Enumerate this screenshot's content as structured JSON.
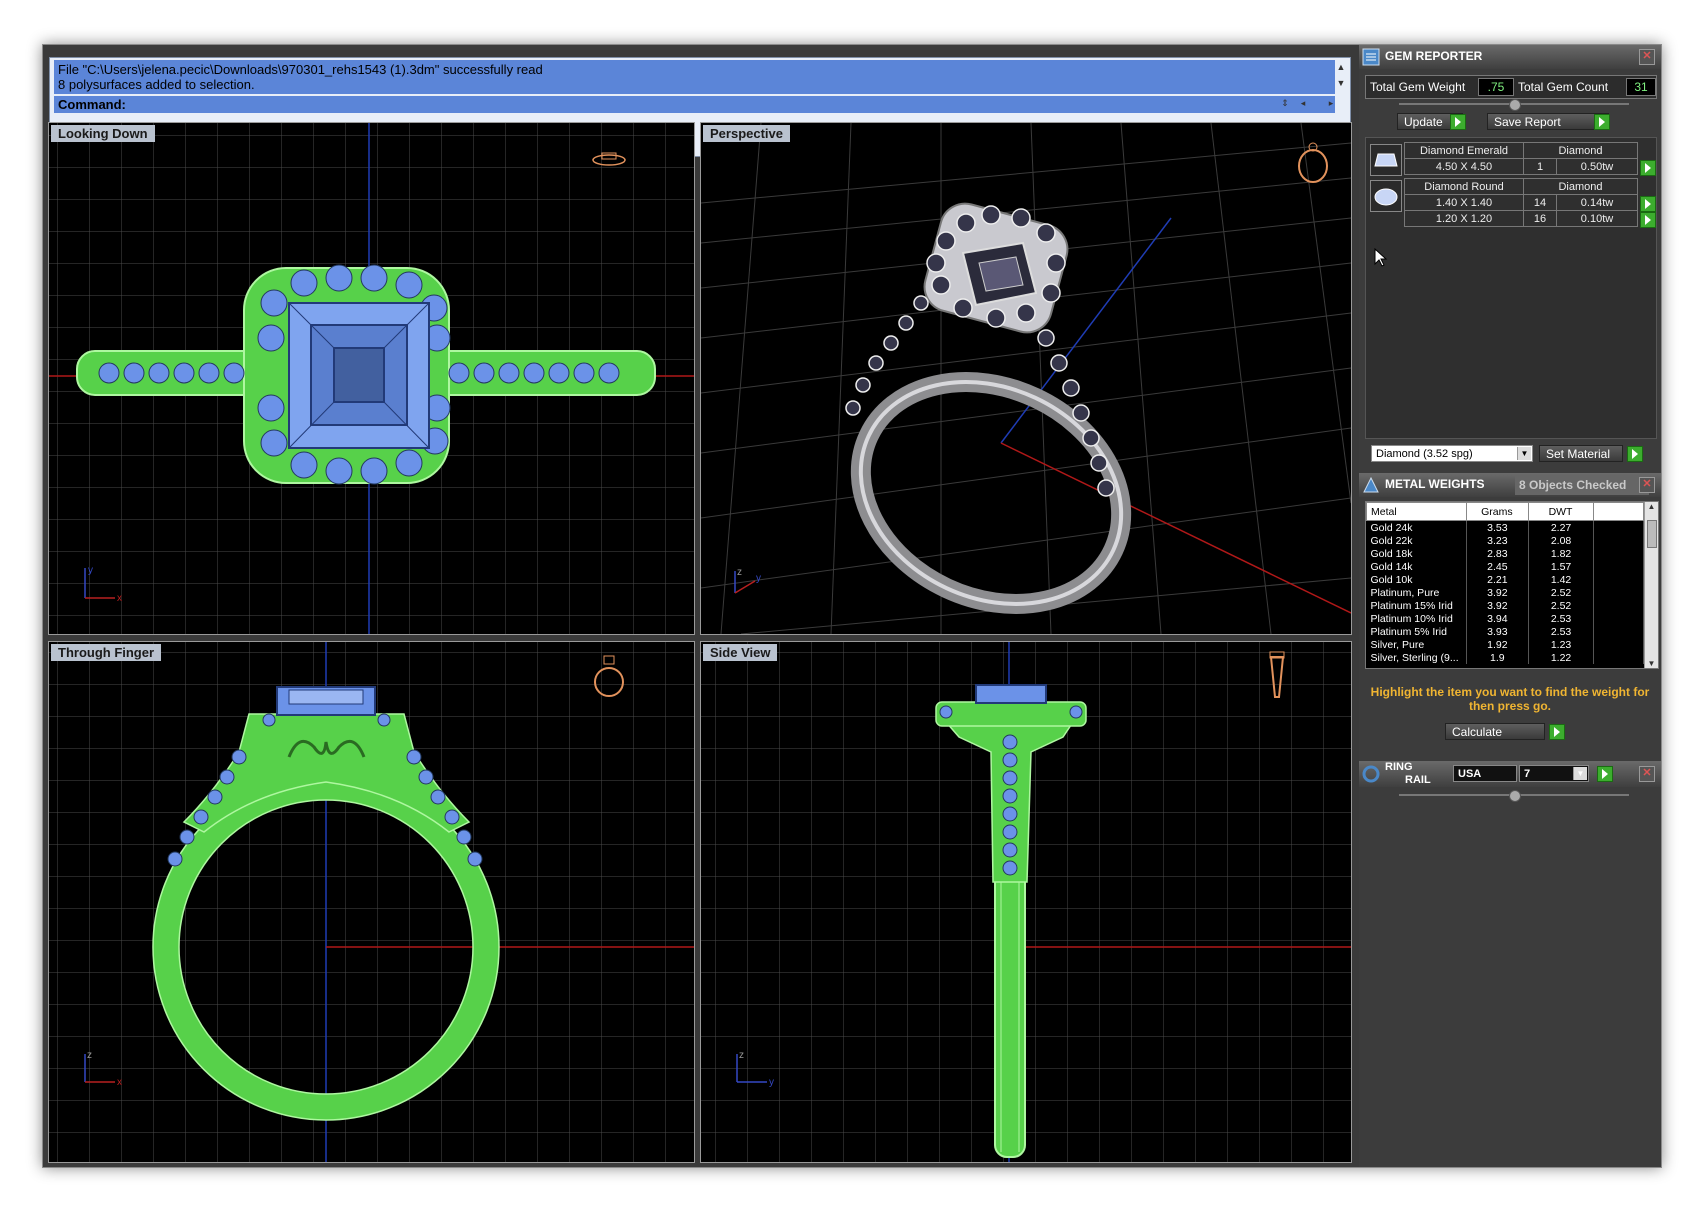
{
  "command": {
    "history": [
      "File \"C:\\Users\\jelena.pecic\\Downloads\\970301_rehs1543 (1).3dm\" successfully read",
      "8 polysurfaces added to selection."
    ],
    "prompt": "Command:"
  },
  "viewports": [
    {
      "title": "Looking Down",
      "axis_a": "y",
      "axis_b": "x"
    },
    {
      "title": "Perspective",
      "axis_a": "z",
      "axis_b": "y"
    },
    {
      "title": "Through Finger",
      "axis_a": "z",
      "axis_b": "x"
    },
    {
      "title": "Side View",
      "axis_a": "z",
      "axis_b": "y"
    }
  ],
  "gem_reporter": {
    "title": "GEM REPORTER",
    "total_weight_label": "Total Gem Weight",
    "total_weight": ".75",
    "total_count_label": "Total Gem Count",
    "total_count": "31",
    "update": "Update",
    "save_report": "Save Report",
    "groups": [
      {
        "name": "Diamond Emerald",
        "material": "Diamond",
        "rows": [
          {
            "size": "4.50 X 4.50",
            "count": "1",
            "weight": "0.50tw"
          }
        ]
      },
      {
        "name": "Diamond Round",
        "material": "Diamond",
        "rows": [
          {
            "size": "1.40 X 1.40",
            "count": "14",
            "weight": "0.14tw"
          },
          {
            "size": "1.20 X 1.20",
            "count": "16",
            "weight": "0.10tw"
          }
        ]
      }
    ],
    "material_select": "Diamond    (3.52 spg)",
    "set_material": "Set Material"
  },
  "metal_weights": {
    "title": "METAL WEIGHTS",
    "status": "8 Objects Checked",
    "columns": [
      "Metal",
      "Grams",
      "DWT"
    ],
    "rows": [
      [
        "Gold 24k",
        "3.53",
        "2.27"
      ],
      [
        "Gold 22k",
        "3.23",
        "2.08"
      ],
      [
        "Gold 18k",
        "2.83",
        "1.82"
      ],
      [
        "Gold 14k",
        "2.45",
        "1.57"
      ],
      [
        "Gold 10k",
        "2.21",
        "1.42"
      ],
      [
        "Platinum, Pure",
        "3.92",
        "2.52"
      ],
      [
        "Platinum 15% Irid",
        "3.92",
        "2.52"
      ],
      [
        "Platinum 10% Irid",
        "3.94",
        "2.53"
      ],
      [
        "Platinum 5% Irid",
        "3.93",
        "2.53"
      ],
      [
        "Silver, Pure",
        "1.92",
        "1.23"
      ],
      [
        "Silver, Sterling (9...",
        "1.9",
        "1.22"
      ]
    ],
    "hint": "Highlight the item you want to find the weight for then press go.",
    "calculate": "Calculate"
  },
  "ring_rail": {
    "title_line1": "RING",
    "title_line2": "RAIL",
    "region": "USA",
    "size": "7"
  }
}
